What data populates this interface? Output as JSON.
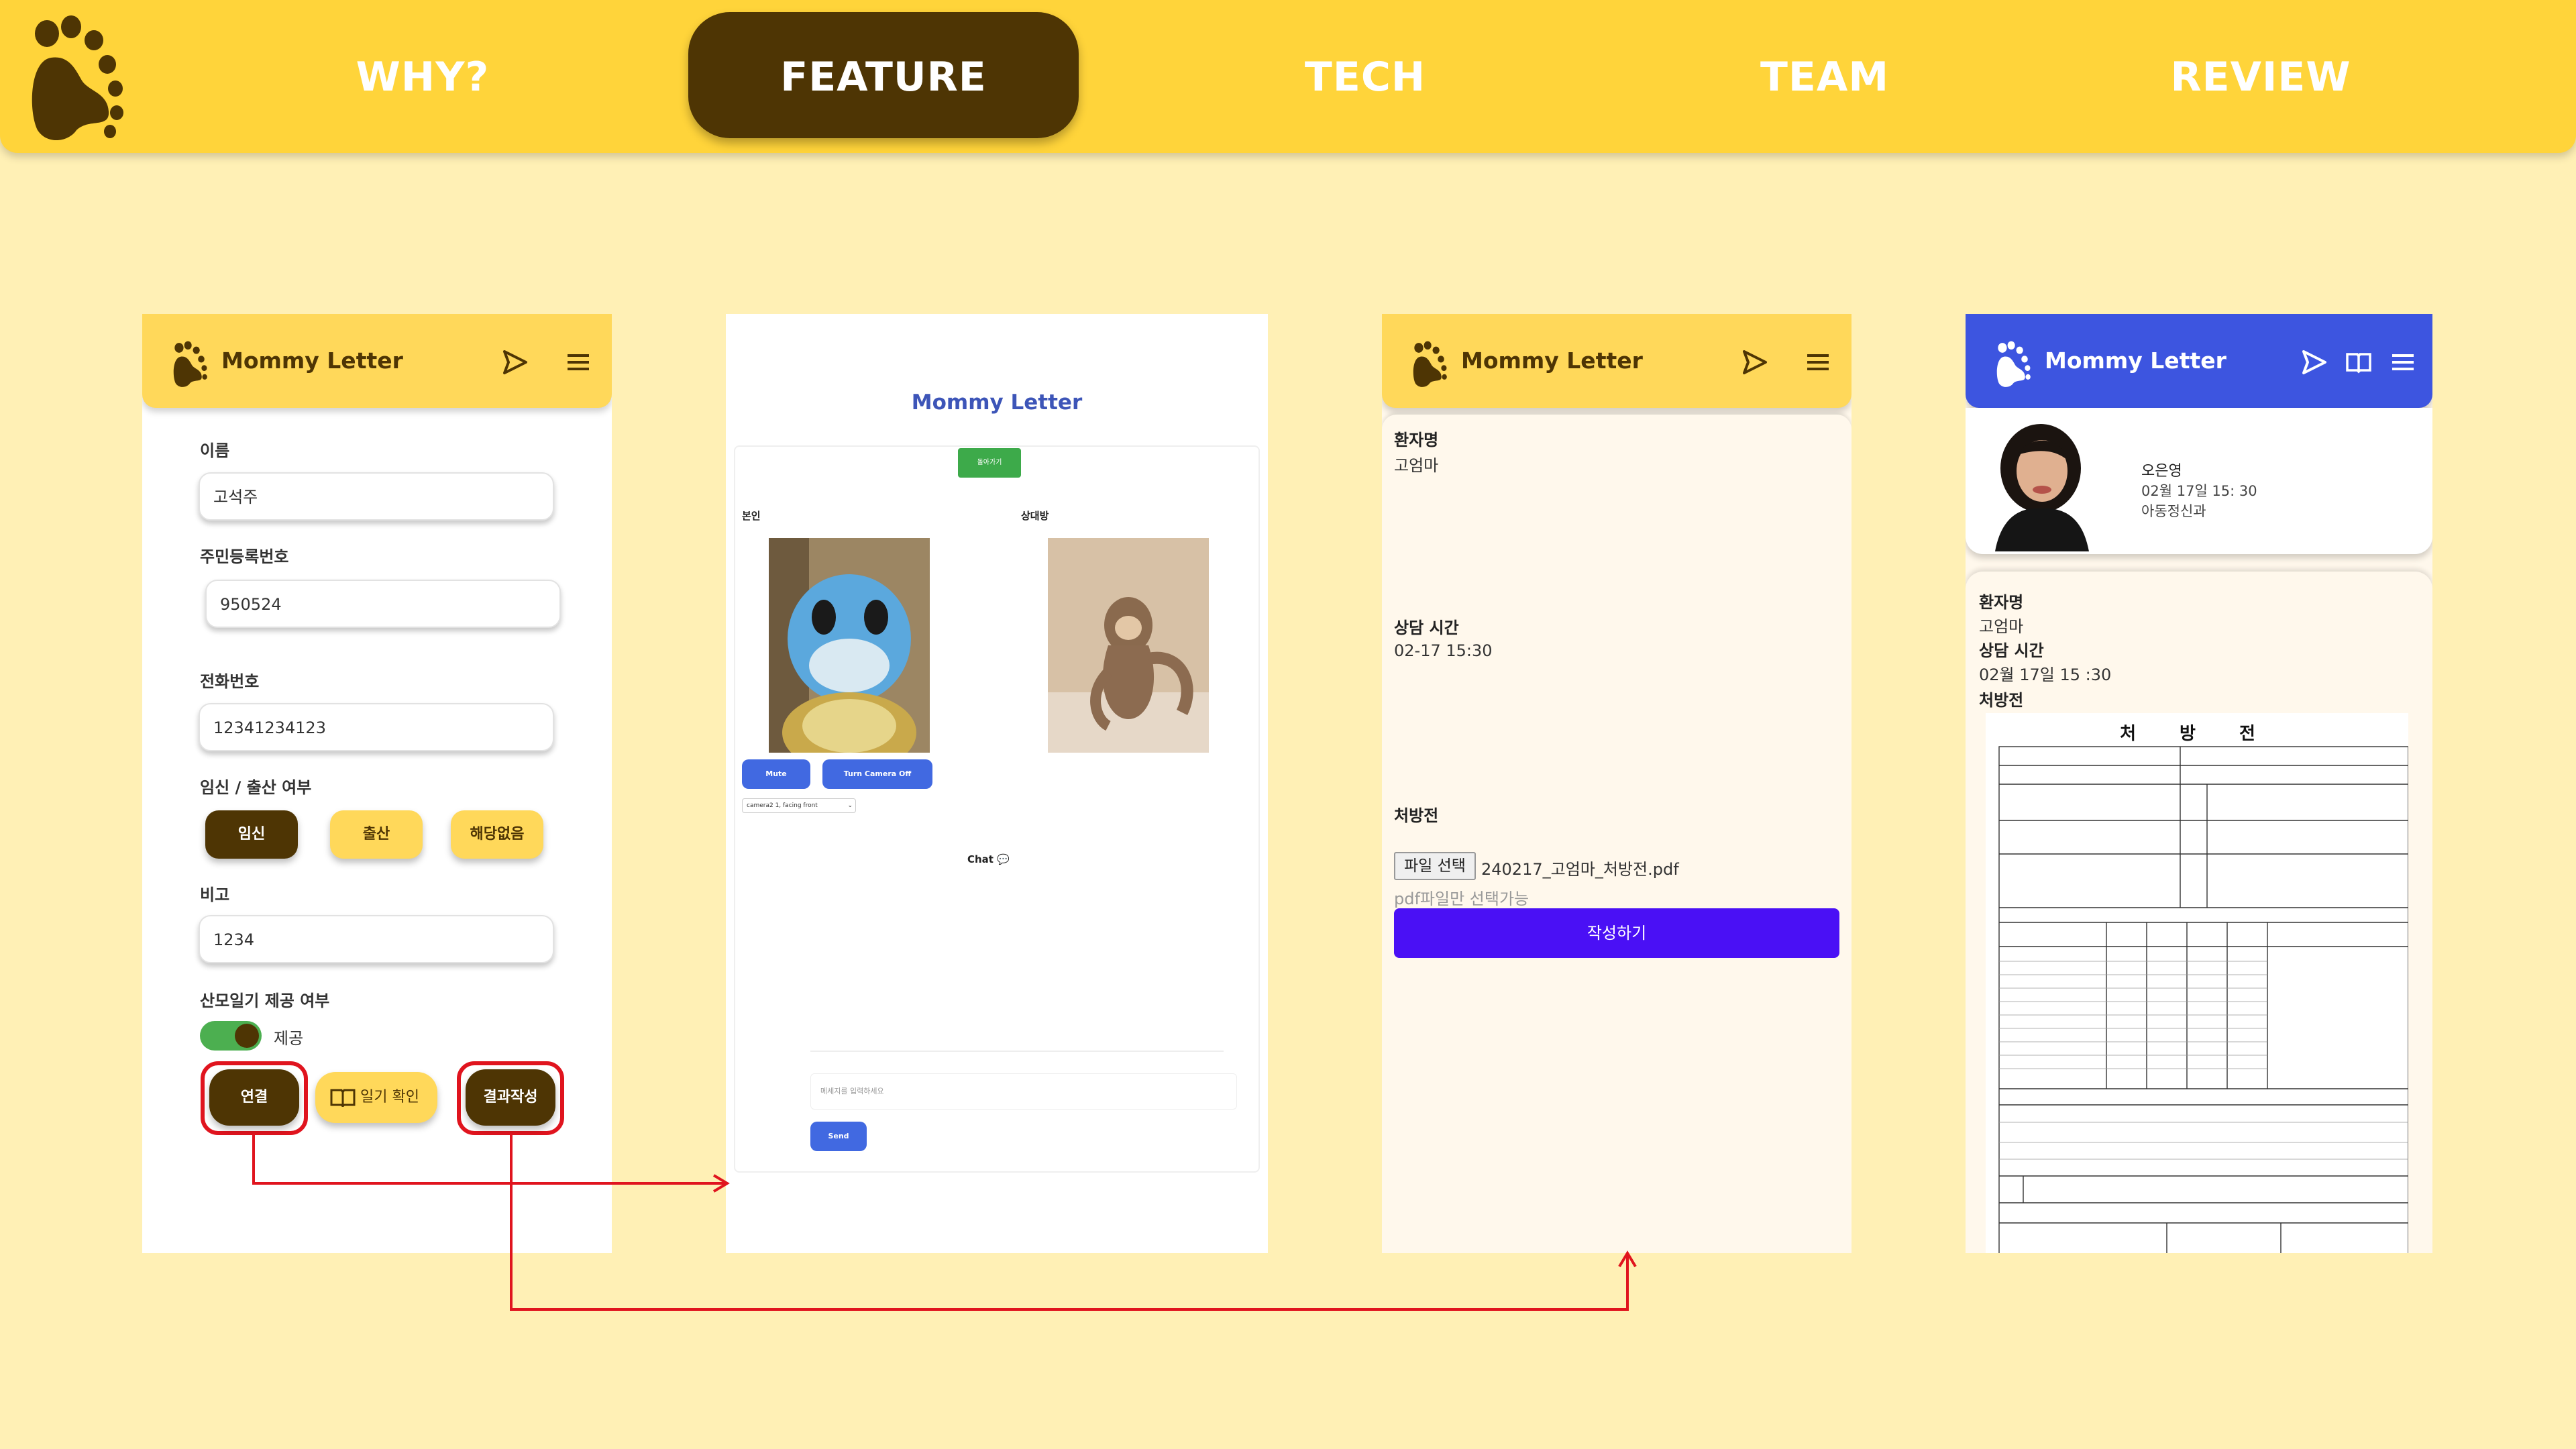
{
  "nav": {
    "items": [
      "WHY?",
      "FEATURE",
      "TECH",
      "TEAM",
      "REVIEW"
    ],
    "active": "FEATURE"
  },
  "colors": {
    "brand_yellow": "#FFD43A",
    "brand_brown": "#4E3504",
    "page_bg": "#FFF0B5",
    "highlight_red": "#E0141E",
    "blue_header": "#3D55E0",
    "submit_purple": "#4A10F5"
  },
  "app": {
    "title": "Mommy Letter"
  },
  "icons": [
    "footprint-logo-icon",
    "send-icon",
    "menu-icon",
    "book-icon",
    "chevron-down-icon"
  ],
  "form": {
    "name_label": "이름",
    "name_value": "고석주",
    "rrn_label": "주민등록번호",
    "rrn_value": "950524",
    "phone_label": "전화번호",
    "phone_value": "12341234123",
    "status_label": "임신 / 출산 여부",
    "status_options": [
      "임신",
      "출산",
      "해당없음"
    ],
    "status_selected": "임신",
    "memo_label": "비고",
    "memo_value": "1234",
    "diary_label": "산모일기 제공 여부",
    "diary_toggle_label": "제공",
    "diary_toggle_on": true,
    "btn_connect": "연결",
    "btn_diary": "일기 확인",
    "btn_result": "결과작성"
  },
  "video": {
    "title": "Mommy Letter",
    "leave_button": "돌아가기",
    "me_label": "본인",
    "peer_label": "상대방",
    "mute_button": "Mute",
    "camera_button": "Turn Camera Off",
    "camera_select": "camera2 1, facing front",
    "chat_label": "Chat 💬",
    "chat_placeholder": "메세지를 입력하세요",
    "send_button": "Send"
  },
  "result": {
    "patient_label": "환자명",
    "patient_value": "고엄마",
    "time_label": "상담 시간",
    "time_value": "02-17 15:30",
    "rx_label": "처방전",
    "file_button": "파일 선택",
    "file_name": "240217_고엄마_처방전.pdf",
    "file_hint": "pdf파일만 선택가능",
    "submit_button": "작성하기"
  },
  "doctor_view": {
    "doctor_name": "오은영",
    "datetime": "02월 17일 15: 30",
    "department": "아동정신과",
    "patient_label": "환자명",
    "patient_value": "고엄마",
    "time_label": "상담 시간",
    "time_value": "02월 17일 15 :30",
    "rx_label": "처방전",
    "rx_doc_title": "처 방 전"
  }
}
